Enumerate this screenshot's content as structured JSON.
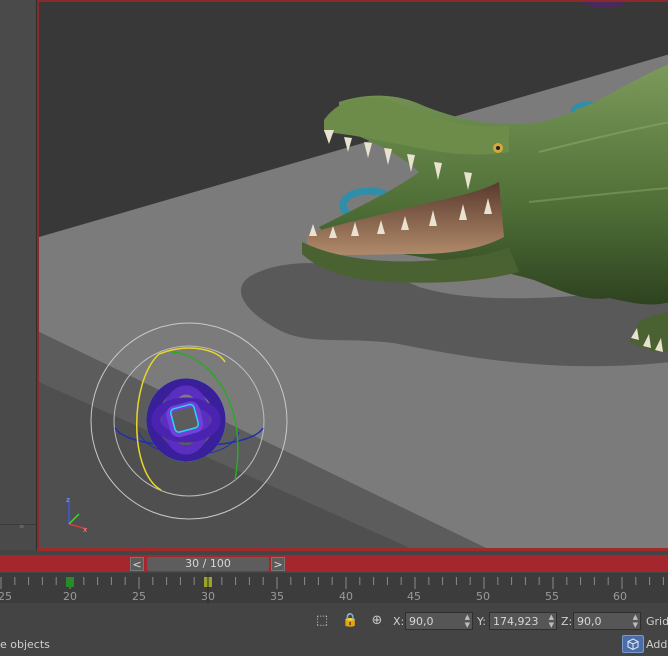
{
  "left_panel": {
    "expand_glyph": "»"
  },
  "time_slider": {
    "prev_label": "<",
    "next_label": ">",
    "position_text": "30 / 100",
    "current_frame": 30,
    "total_frames": 100
  },
  "timeline": {
    "tick_labels": [
      "25",
      "20",
      "25",
      "30",
      "35",
      "40",
      "45",
      "50",
      "55",
      "60"
    ],
    "keyframes": [
      20,
      30
    ]
  },
  "status_bar": {
    "x_label": "X:",
    "x_value": "90,0",
    "y_label": "Y:",
    "y_value": "174,923",
    "z_label": "Z:",
    "z_value": "90,0",
    "grid_label": "Grid",
    "prompt_text": "e objects",
    "add_label": "Add"
  },
  "colors": {
    "viewport_border": "#8a2a2a",
    "time_bar": "#a6262d",
    "keyframe": "#2a8a2a",
    "current_frame": "#9aa32a"
  }
}
